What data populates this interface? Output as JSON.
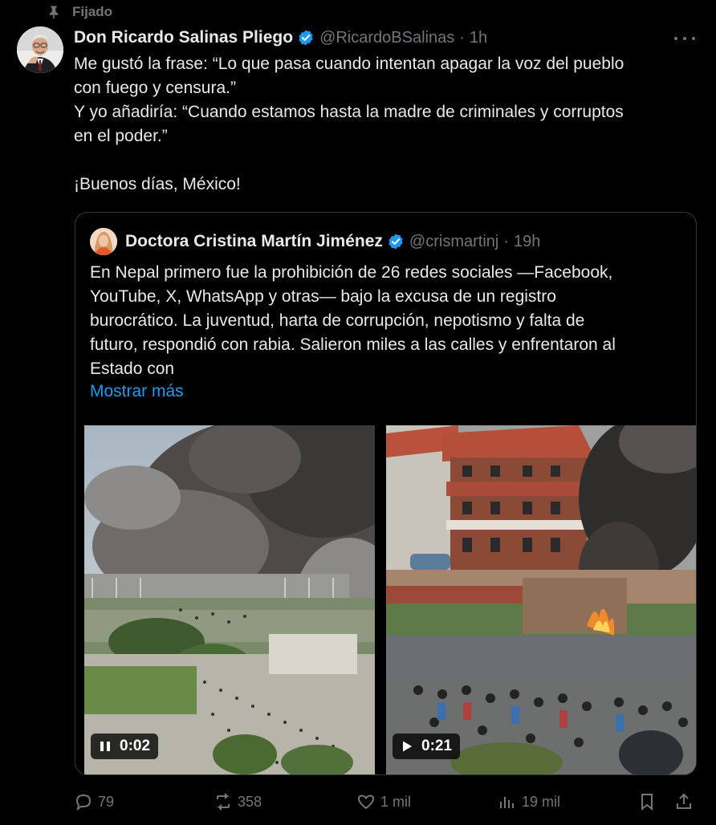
{
  "pinned_label": "Fijado",
  "post": {
    "author_name": "Don Ricardo Salinas Pliego",
    "author_handle": "@RicardoBSalinas",
    "separator": "·",
    "time": "1h",
    "text_lines": [
      "Me gustó la frase: “Lo que pasa cuando intentan apagar la voz del pueblo",
      "con fuego y censura.”",
      "Y yo añadiría: “Cuando estamos hasta la madre de criminales y corruptos",
      "en el poder.”",
      "",
      "¡Buenos días, México!"
    ]
  },
  "quote": {
    "author_name": "Doctora Cristina Martín Jiménez",
    "author_handle": "@crismartinj",
    "separator": "·",
    "time": "19h",
    "text_lines": [
      "En Nepal primero fue la prohibición de 26 redes sociales —Facebook,",
      "YouTube, X, WhatsApp y otras— bajo la excusa de un registro",
      "burocrático. La juventud, harta de corrupción, nepotismo y falta de",
      "futuro, respondió con rabia. Salieron miles a las calles y enfrentaron al",
      "Estado con"
    ],
    "show_more": "Mostrar más",
    "media": [
      {
        "duration": "0:02",
        "state": "pause-icon"
      },
      {
        "duration": "0:21",
        "state": "play-icon"
      }
    ]
  },
  "actions": {
    "replies": "79",
    "reposts": "358",
    "likes": "1 mil",
    "views": "19 mil"
  },
  "colors": {
    "background": "#000000",
    "text": "#e7e9ea",
    "muted": "#71767b",
    "link": "#1d9bf0",
    "verified": "#1d9bf0"
  }
}
